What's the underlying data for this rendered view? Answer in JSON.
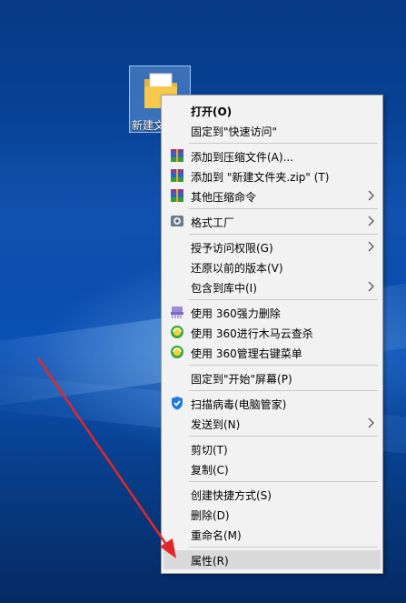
{
  "desktop": {
    "folder_label": "新建文件夹",
    "colors": {
      "arrow": "#e02828",
      "folder": "#f6c84c"
    }
  },
  "context_menu": {
    "items": [
      {
        "id": "open",
        "label": "打开(O)",
        "bold": true,
        "icon": ""
      },
      {
        "id": "pin-quick",
        "label": "固定到\"快速访问\"",
        "icon": ""
      },
      {
        "id": "add-archive",
        "label": "添加到压缩文件(A)...",
        "icon": "winrar-icon"
      },
      {
        "id": "add-zip",
        "label": "添加到 \"新建文件夹.zip\" (T)",
        "icon": "winrar-icon"
      },
      {
        "id": "other-compress",
        "label": "其他压缩命令",
        "icon": "winrar-icon",
        "submenu": true
      },
      {
        "id": "format-factory",
        "label": "格式工厂",
        "icon": "format-factory-icon",
        "submenu": true
      },
      {
        "id": "grant-access",
        "label": "授予访问权限(G)",
        "icon": "",
        "submenu": true
      },
      {
        "id": "restore-prev",
        "label": "还原以前的版本(V)",
        "icon": ""
      },
      {
        "id": "include-library",
        "label": "包含到库中(I)",
        "icon": "",
        "submenu": true
      },
      {
        "id": "360-delete",
        "label": "使用 360强力删除",
        "icon": "360-shred-icon"
      },
      {
        "id": "360-scan",
        "label": "使用 360进行木马云查杀",
        "icon": "360-scan-icon"
      },
      {
        "id": "360-menu",
        "label": "使用 360管理右键菜单",
        "icon": "360-menu-icon"
      },
      {
        "id": "pin-start",
        "label": "固定到\"开始\"屏幕(P)",
        "icon": ""
      },
      {
        "id": "scan-virus",
        "label": "扫描病毒(电脑管家)",
        "icon": "tencent-shield-icon"
      },
      {
        "id": "send-to",
        "label": "发送到(N)",
        "icon": "",
        "submenu": true
      },
      {
        "id": "cut",
        "label": "剪切(T)",
        "icon": ""
      },
      {
        "id": "copy",
        "label": "复制(C)",
        "icon": ""
      },
      {
        "id": "create-shortcut",
        "label": "创建快捷方式(S)",
        "icon": ""
      },
      {
        "id": "delete",
        "label": "删除(D)",
        "icon": ""
      },
      {
        "id": "rename",
        "label": "重命名(M)",
        "icon": ""
      },
      {
        "id": "properties",
        "label": "属性(R)",
        "icon": "",
        "highlighted": true
      }
    ]
  }
}
